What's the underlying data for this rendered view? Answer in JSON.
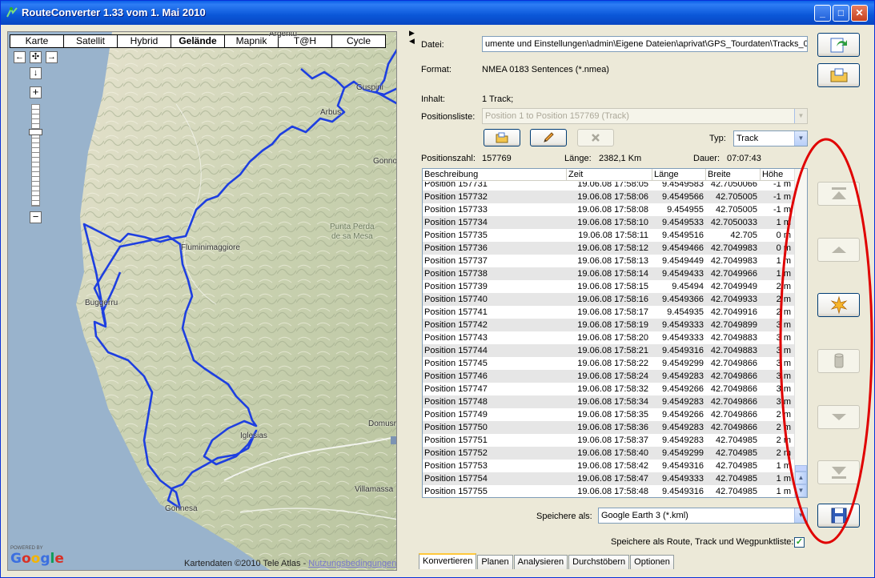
{
  "window": {
    "title": "RouteConverter 1.33 vom 1. Mai 2010",
    "minimize": "_",
    "maximize": "□",
    "close": "✕"
  },
  "map": {
    "tabs": [
      "Karte",
      "Satellit",
      "Hybrid",
      "Gelände",
      "Mapnik",
      "T@H",
      "Cycle"
    ],
    "active_tab": "Gelände",
    "pan": {
      "left": "←",
      "center": "✣",
      "right": "→",
      "down": "↓"
    },
    "zoom": {
      "plus": "+",
      "minus": "−"
    },
    "labels": {
      "arbus": "Arbus",
      "guspini": "Guspini",
      "gonnosfanadiga": "Gonno",
      "fluminimaggiore": "Fluminimaggiore",
      "buggerru": "Buggerru",
      "iglesias": "Iglesias",
      "domusnovas": "Domusr",
      "villamassargia": "Villamassa",
      "gonnesa": "Gonnesa",
      "punta_perda": "Punta Perda",
      "de_sa_mesa": "de sa Mesa",
      "argentu": "Argentu"
    },
    "powered_by": "POWERED BY",
    "logo_letters": [
      "G",
      "o",
      "o",
      "g",
      "l",
      "e"
    ],
    "attribution": "Kartendaten ©2010 Tele Atlas - ",
    "attribution_link": "Nutzungsbedingungen"
  },
  "panel": {
    "datei_label": "Datei:",
    "datei_value": "umente und Einstellungen\\admin\\Eigene Dateien\\aprivat\\GPS_Tourdaten\\Tracks_08",
    "format_label": "Format:",
    "format_value": "NMEA 0183 Sentences (*.nmea)",
    "inhalt_label": "Inhalt:",
    "inhalt_value": "1 Track;",
    "positionsliste_label": "Positionsliste:",
    "positionsliste_value": "Position 1 to Position 157769 (Track)",
    "typ_label": "Typ:",
    "typ_value": "Track",
    "positionszahl_label": "Positionszahl:",
    "positionszahl_value": "157769",
    "laenge_label": "Länge:",
    "laenge_value": "2382,1 Km",
    "dauer_label": "Dauer:",
    "dauer_value": "07:07:43",
    "speichere_als_label": "Speichere als:",
    "speichere_als_value": "Google Earth 3 (*.kml)",
    "speichere_checkbox_label": "Speichere als Route, Track und Wegpunktliste:",
    "speichere_checkbox_checked": "✓"
  },
  "table": {
    "headers": [
      "Beschreibung",
      "Zeit",
      "Länge",
      "Breite",
      "Höhe"
    ],
    "rows": [
      [
        "Position 157731",
        "19.06.08 17:58:05",
        "9.4549583",
        "42.7050066",
        "-1 m"
      ],
      [
        "Position 157732",
        "19.06.08 17:58:06",
        "9.4549566",
        "42.705005",
        "-1 m"
      ],
      [
        "Position 157733",
        "19.06.08 17:58:08",
        "9.454955",
        "42.705005",
        "-1 m"
      ],
      [
        "Position 157734",
        "19.06.08 17:58:10",
        "9.4549533",
        "42.7050033",
        "1 m"
      ],
      [
        "Position 157735",
        "19.06.08 17:58:11",
        "9.4549516",
        "42.705",
        "0 m"
      ],
      [
        "Position 157736",
        "19.06.08 17:58:12",
        "9.4549466",
        "42.7049983",
        "0 m"
      ],
      [
        "Position 157737",
        "19.06.08 17:58:13",
        "9.4549449",
        "42.7049983",
        "1 m"
      ],
      [
        "Position 157738",
        "19.06.08 17:58:14",
        "9.4549433",
        "42.7049966",
        "1 m"
      ],
      [
        "Position 157739",
        "19.06.08 17:58:15",
        "9.45494",
        "42.7049949",
        "2 m"
      ],
      [
        "Position 157740",
        "19.06.08 17:58:16",
        "9.4549366",
        "42.7049933",
        "2 m"
      ],
      [
        "Position 157741",
        "19.06.08 17:58:17",
        "9.454935",
        "42.7049916",
        "2 m"
      ],
      [
        "Position 157742",
        "19.06.08 17:58:19",
        "9.4549333",
        "42.7049899",
        "3 m"
      ],
      [
        "Position 157743",
        "19.06.08 17:58:20",
        "9.4549333",
        "42.7049883",
        "3 m"
      ],
      [
        "Position 157744",
        "19.06.08 17:58:21",
        "9.4549316",
        "42.7049883",
        "3 m"
      ],
      [
        "Position 157745",
        "19.06.08 17:58:22",
        "9.4549299",
        "42.7049866",
        "3 m"
      ],
      [
        "Position 157746",
        "19.06.08 17:58:24",
        "9.4549283",
        "42.7049866",
        "3 m"
      ],
      [
        "Position 157747",
        "19.06.08 17:58:32",
        "9.4549266",
        "42.7049866",
        "3 m"
      ],
      [
        "Position 157748",
        "19.06.08 17:58:34",
        "9.4549283",
        "42.7049866",
        "3 m"
      ],
      [
        "Position 157749",
        "19.06.08 17:58:35",
        "9.4549266",
        "42.7049866",
        "2 m"
      ],
      [
        "Position 157750",
        "19.06.08 17:58:36",
        "9.4549283",
        "42.7049866",
        "2 m"
      ],
      [
        "Position 157751",
        "19.06.08 17:58:37",
        "9.4549283",
        "42.704985",
        "2 m"
      ],
      [
        "Position 157752",
        "19.06.08 17:58:40",
        "9.4549299",
        "42.704985",
        "2 m"
      ],
      [
        "Position 157753",
        "19.06.08 17:58:42",
        "9.4549316",
        "42.704985",
        "1 m"
      ],
      [
        "Position 157754",
        "19.06.08 17:58:47",
        "9.4549333",
        "42.704985",
        "1 m"
      ],
      [
        "Position 157755",
        "19.06.08 17:58:48",
        "9.4549316",
        "42.704985",
        "1 m"
      ]
    ]
  },
  "tabs": [
    "Konvertieren",
    "Planen",
    "Analysieren",
    "Durchstöbern",
    "Optionen"
  ],
  "active_tab": "Konvertieren",
  "icons": {
    "dropdown_arrow": "▼",
    "scroll_up": "▲",
    "scroll_down": "▼",
    "splitter_right": "▶",
    "splitter_left": "◀",
    "delete_glyph": "✕"
  },
  "colors": {
    "route": "#1E3FE0",
    "annotation_ellipse": "#E00000",
    "title_bar": "#0A57D8"
  }
}
